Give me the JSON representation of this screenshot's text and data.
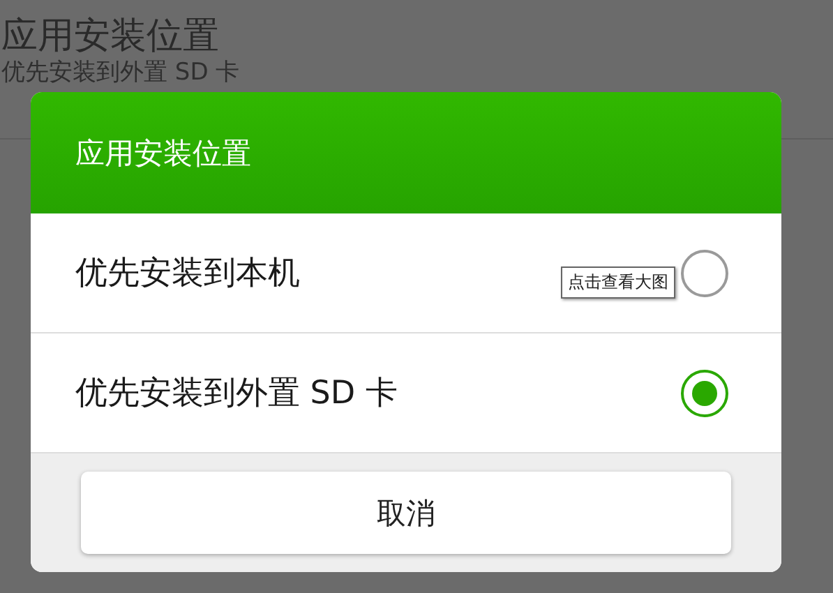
{
  "background": {
    "title": "应用安装位置",
    "subtitle": "优先安装到外置 SD 卡"
  },
  "dialog": {
    "title": "应用安装位置",
    "options": [
      {
        "label": "优先安装到本机",
        "selected": false
      },
      {
        "label": "优先安装到外置 SD 卡",
        "selected": true
      }
    ],
    "button": "取消"
  },
  "tooltip": "点击查看大图"
}
